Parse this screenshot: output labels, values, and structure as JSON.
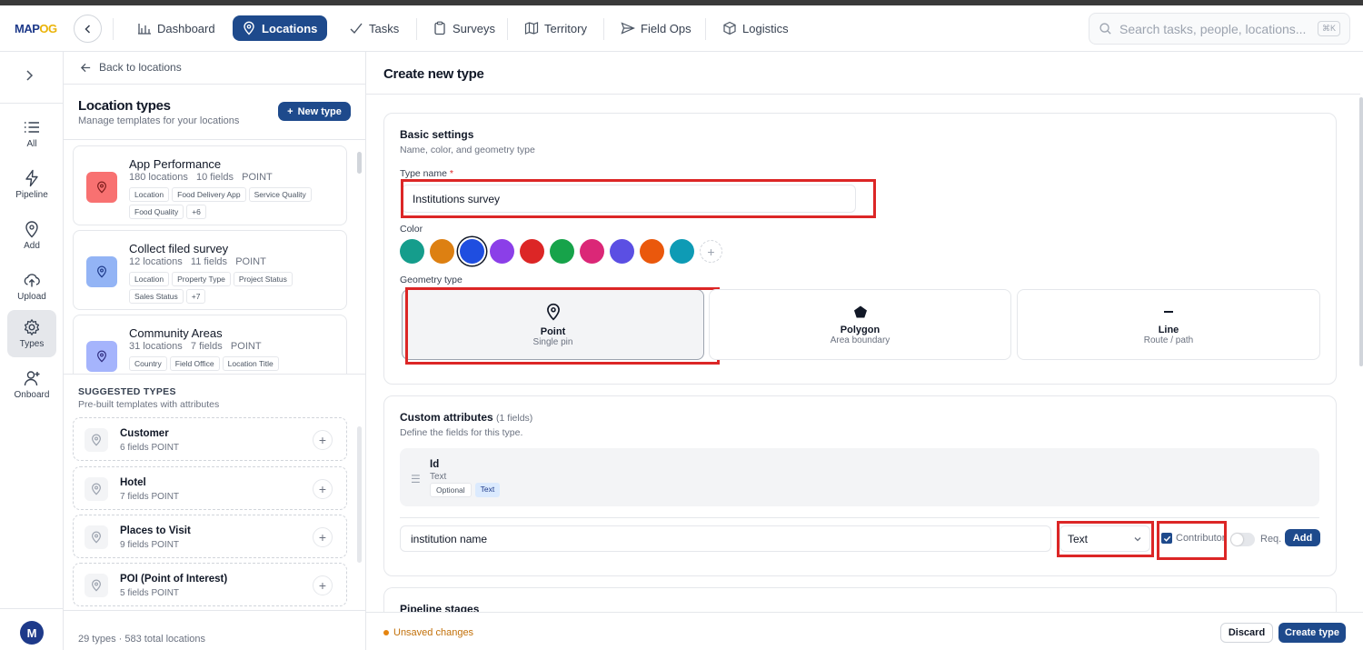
{
  "app": {
    "logo_main": "MAP",
    "logo_accent": "OG"
  },
  "nav": {
    "tabs": [
      {
        "label": "Dashboard",
        "icon": "bar-chart-icon"
      },
      {
        "label": "Locations",
        "icon": "location-pin-icon",
        "active": true
      },
      {
        "label": "Tasks",
        "icon": "checkmark-icon"
      },
      {
        "label": "Surveys",
        "icon": "clipboard-icon"
      },
      {
        "label": "Territory",
        "icon": "map-icon"
      },
      {
        "label": "Field Ops",
        "icon": "send-icon"
      },
      {
        "label": "Logistics",
        "icon": "box-icon"
      }
    ],
    "search_placeholder": "Search tasks, people, locations...",
    "search_shortcut": "⌘K"
  },
  "rail": {
    "items": [
      {
        "label": "All",
        "icon": "list-icon"
      },
      {
        "label": "Pipeline",
        "icon": "lightning-icon"
      },
      {
        "label": "Add",
        "icon": "location-pin-icon"
      },
      {
        "label": "Upload",
        "icon": "cloud-upload-icon"
      },
      {
        "label": "Types",
        "icon": "gear-icon",
        "active": true
      },
      {
        "label": "Onboard",
        "icon": "user-plus-icon"
      }
    ],
    "avatar_initial": "M"
  },
  "left_panel": {
    "back_label": "Back to locations",
    "title": "Location types",
    "subtitle": "Manage templates for your locations",
    "new_type_label": "New type",
    "types": [
      {
        "name": "App Performance",
        "locations": "180 locations",
        "fields": "10 fields",
        "geometry": "POINT",
        "color": "#f87171",
        "tags": [
          "Location",
          "Food Delivery App",
          "Service Quality",
          "Food Quality",
          "+6"
        ]
      },
      {
        "name": "Collect filed survey",
        "locations": "12 locations",
        "fields": "11 fields",
        "geometry": "POINT",
        "color": "#93b4f5",
        "tags": [
          "Location",
          "Property Type",
          "Project Status",
          "Sales Status",
          "+7"
        ]
      },
      {
        "name": "Community Areas",
        "locations": "31 locations",
        "fields": "7 fields",
        "geometry": "POINT",
        "color": "#a5b4fc",
        "tags": [
          "Country",
          "Field Office",
          "Location Title"
        ]
      }
    ],
    "suggested_title": "SUGGESTED TYPES",
    "suggested_subtitle": "Pre-built templates with attributes",
    "suggested": [
      {
        "name": "Customer",
        "meta": "6 fields  POINT"
      },
      {
        "name": "Hotel",
        "meta": "7 fields  POINT"
      },
      {
        "name": "Places to Visit",
        "meta": "9 fields  POINT"
      },
      {
        "name": "POI (Point of Interest)",
        "meta": "5 fields  POINT"
      }
    ],
    "footer": "29 types · 583 total locations"
  },
  "main": {
    "title": "Create new type",
    "basic": {
      "title": "Basic settings",
      "subtitle": "Name, color, and geometry type",
      "type_name_label": "Type name",
      "required_mark": "*",
      "type_name_value": "Institutions survey",
      "color_label": "Color",
      "colors": [
        "#159d8c",
        "#dd8012",
        "#1f4ee0",
        "#8b3fe8",
        "#dc2626",
        "#17a34a",
        "#db2777",
        "#5b4fe3",
        "#ea580c",
        "#0e9bb5"
      ],
      "selected_color_index": 2,
      "geometry_label": "Geometry type",
      "geometry_options": [
        {
          "label": "Point",
          "sub": "Single pin",
          "icon": "location-pin-icon",
          "selected": true
        },
        {
          "label": "Polygon",
          "sub": "Area boundary",
          "icon": "pentagon-icon"
        },
        {
          "label": "Line",
          "sub": "Route / path",
          "icon": "line-icon"
        }
      ]
    },
    "attributes": {
      "title": "Custom attributes",
      "count": "(1 fields)",
      "subtitle": "Define the fields for this type.",
      "items": [
        {
          "name": "Id",
          "type": "Text",
          "badges": [
            "Optional",
            "Text"
          ]
        }
      ],
      "new_field_value": "institution name",
      "new_field_type": "Text",
      "contributor_label": "Contributor",
      "contributor_checked": true,
      "required_label": "Req.",
      "add_label": "Add"
    },
    "pipeline_title": "Pipeline stages"
  },
  "footer": {
    "unsaved": "Unsaved changes",
    "discard": "Discard",
    "create": "Create type"
  }
}
